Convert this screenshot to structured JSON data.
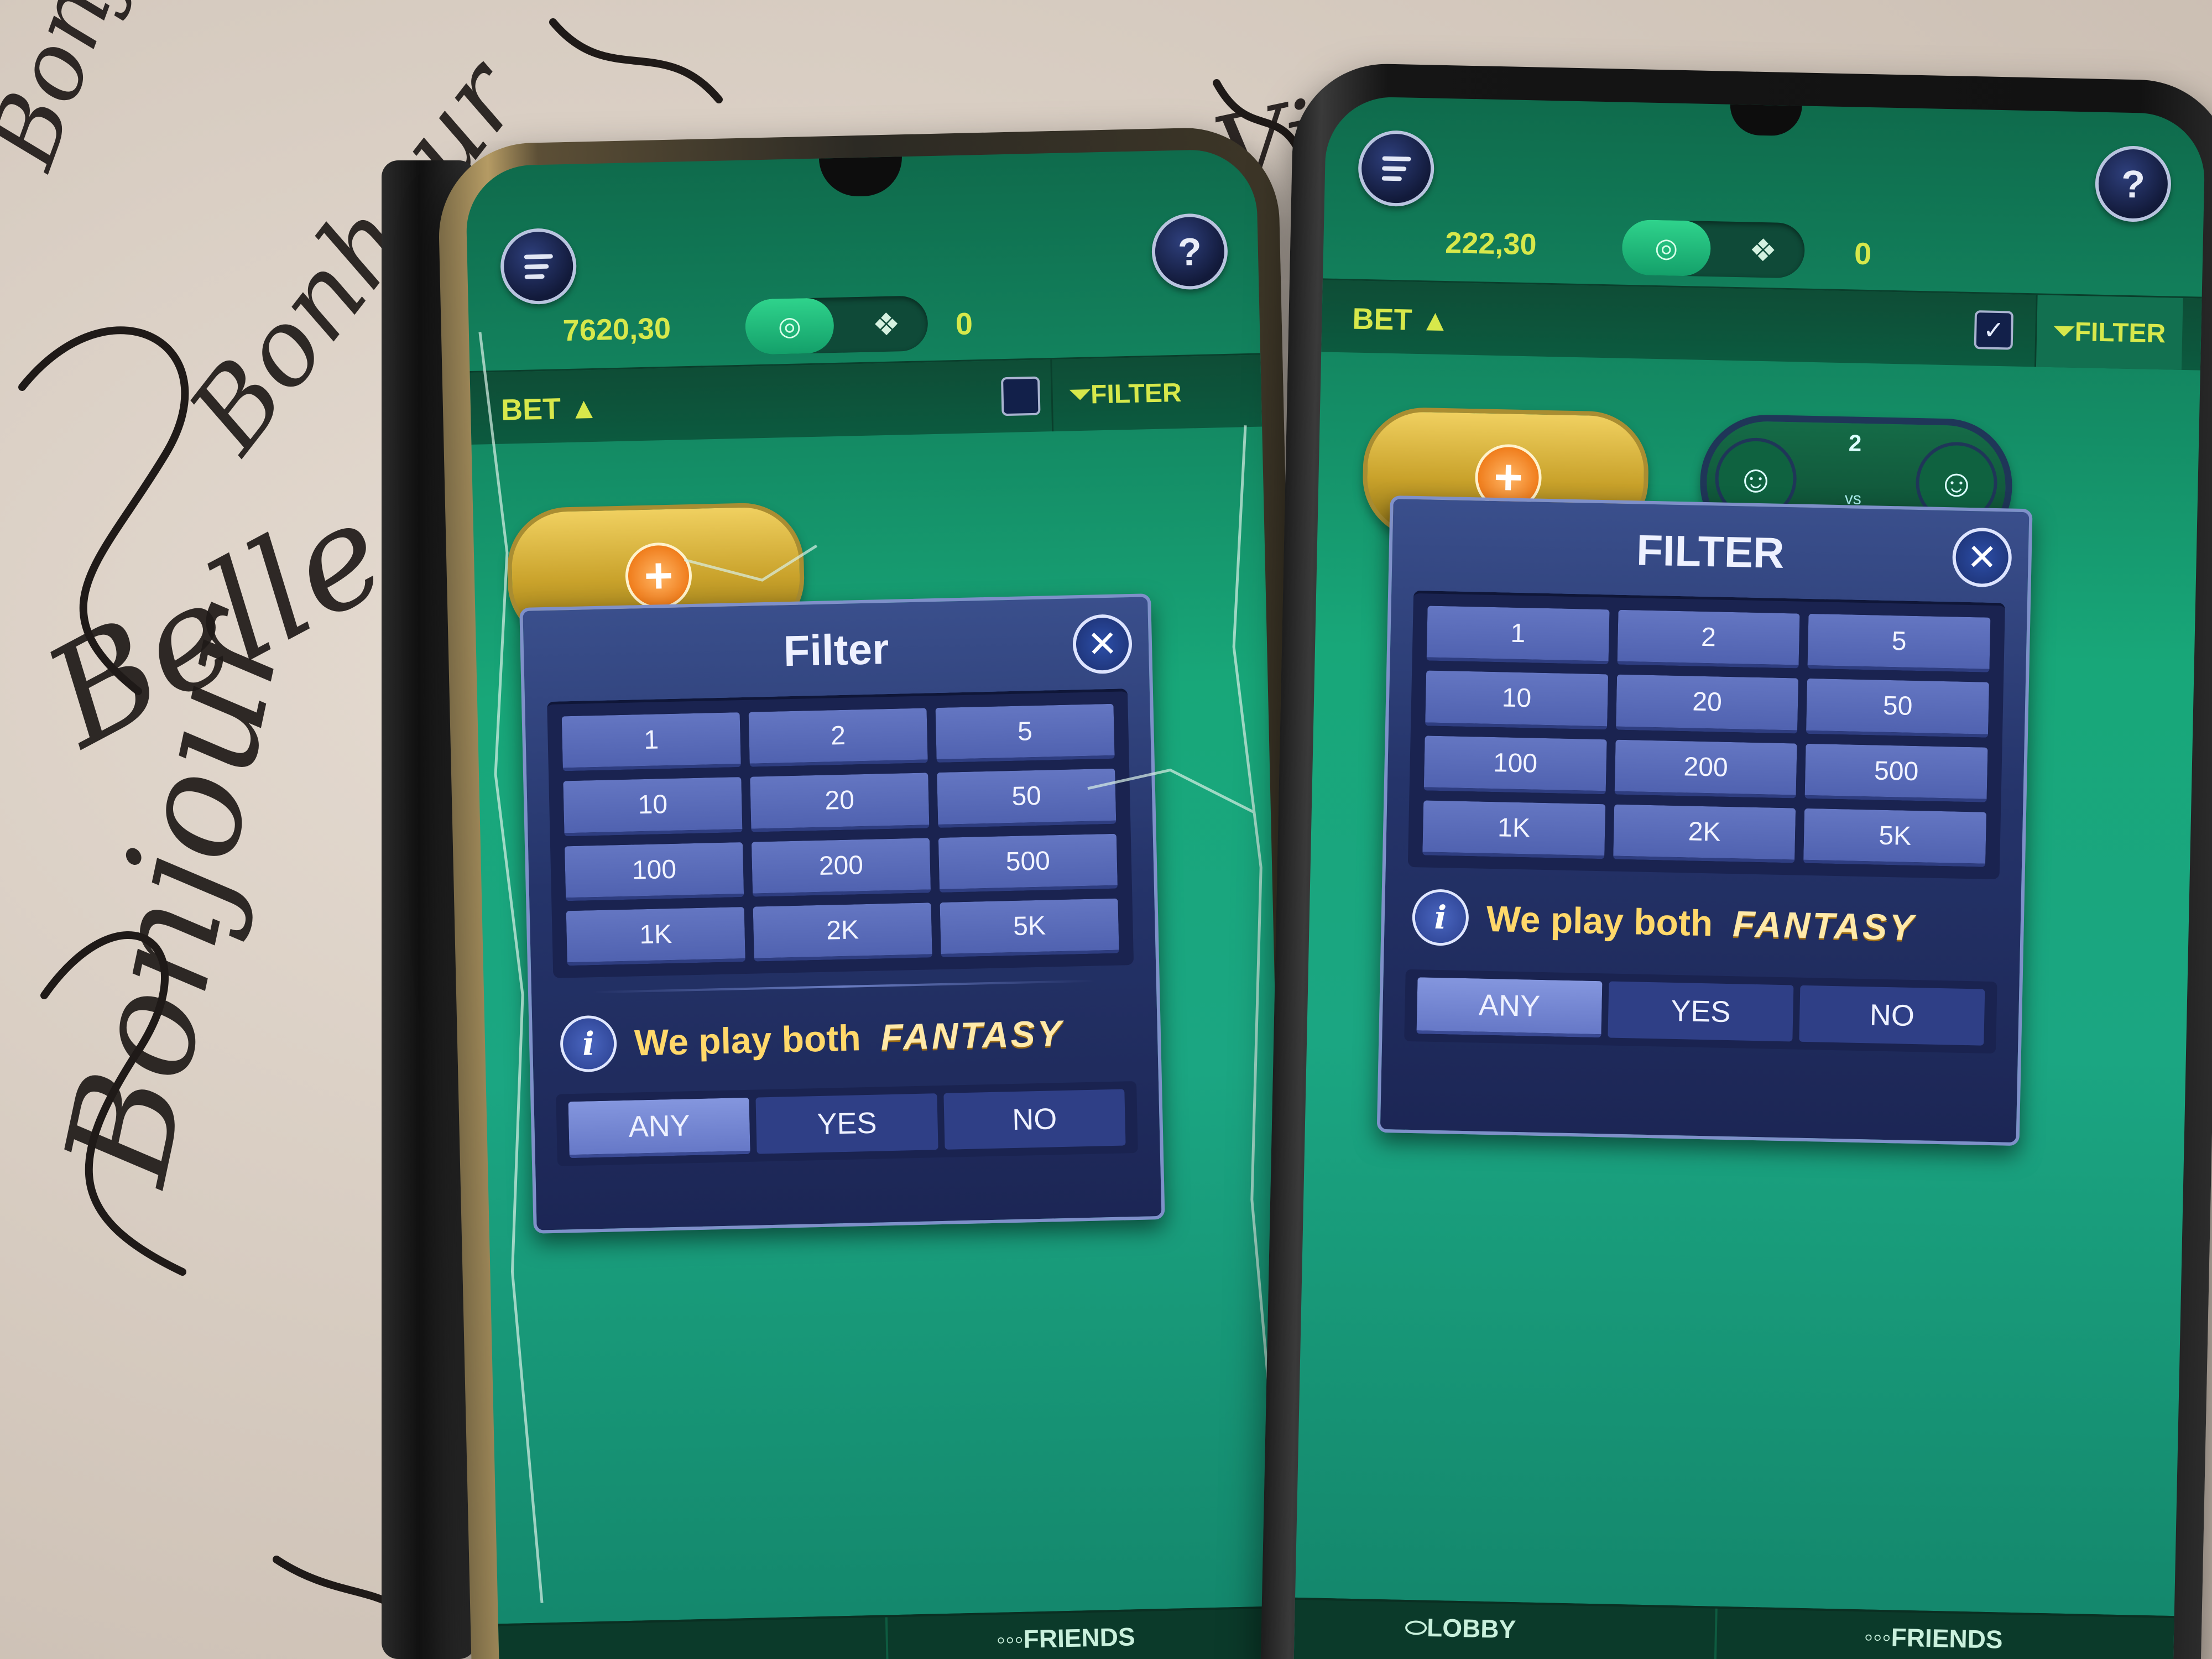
{
  "background": {
    "scribbles": [
      "Bonjour",
      "Belle",
      "Bonheur",
      "Vie",
      "Bonjour"
    ]
  },
  "left_phone": {
    "balance": "7620,30",
    "count": "0",
    "bet_label": "BET",
    "filter_label": "FILTER",
    "checkbox_checked": false,
    "modal": {
      "title": "Filter",
      "amounts": [
        "1",
        "2",
        "5",
        "10",
        "20",
        "50",
        "100",
        "200",
        "500",
        "1K",
        "2K",
        "5K"
      ],
      "info_text": "We play both",
      "info_brand": "FANTASY",
      "choices": [
        "ANY",
        "YES",
        "NO"
      ],
      "selected_choice": "ANY"
    },
    "bottom_nav": {
      "friends_label": "FRIENDS"
    }
  },
  "right_phone": {
    "balance": "222,30",
    "count": "0",
    "bet_label": "BET",
    "filter_label": "FILTER",
    "checkbox_checked": true,
    "vs_count": "2",
    "vs_label": "vs",
    "modal": {
      "title": "FILTER",
      "amounts": [
        "1",
        "2",
        "5",
        "10",
        "20",
        "50",
        "100",
        "200",
        "500",
        "1K",
        "2K",
        "5K"
      ],
      "info_text": "We play both",
      "info_brand": "FANTASY",
      "choices": [
        "ANY",
        "YES",
        "NO"
      ],
      "selected_choice": "ANY"
    },
    "bottom_nav": {
      "lobby_label": "LOBBY",
      "friends_label": "FRIENDS"
    }
  },
  "colors": {
    "screen_green": "#18a779",
    "accent_yellow": "#d7e84b",
    "modal_blue": "#25346a",
    "button_blue": "#5062b0",
    "brand_gold": "#ffe9a8"
  },
  "icons": [
    "menu-icon",
    "help-icon",
    "coin-icon",
    "pineapple-icon",
    "caret-up-icon",
    "funnel-icon",
    "close-icon",
    "info-icon",
    "plus-icon",
    "user-icon",
    "friends-icon"
  ]
}
